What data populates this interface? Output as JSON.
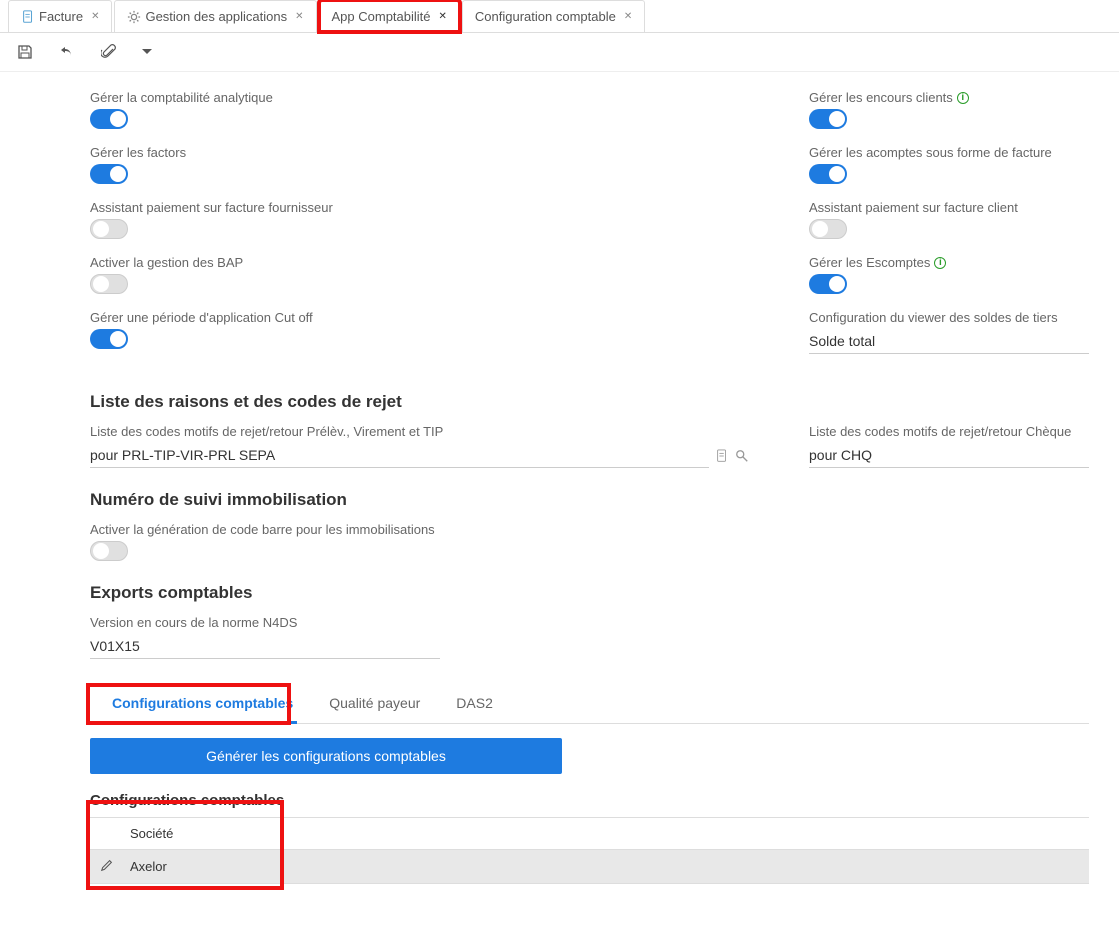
{
  "topTabs": [
    {
      "label": "Facture",
      "icon": "doc"
    },
    {
      "label": "Gestion des applications",
      "icon": "gear"
    },
    {
      "label": "App Comptabilité",
      "icon": null,
      "highlight": true
    },
    {
      "label": "Configuration comptable",
      "icon": null
    }
  ],
  "leftCol": [
    {
      "label": "Gérer la comptabilité analytique",
      "on": true
    },
    {
      "label": "Gérer les factors",
      "on": true
    },
    {
      "label": "Assistant paiement sur facture fournisseur",
      "on": false
    },
    {
      "label": "Activer la gestion des BAP",
      "on": false
    },
    {
      "label": "Gérer une période d'application Cut off",
      "on": true
    }
  ],
  "rightCol": [
    {
      "label": "Gérer les encours clients",
      "on": true,
      "info": true
    },
    {
      "label": "Gérer les acomptes sous forme de facture",
      "on": true
    },
    {
      "label": "Assistant paiement sur facture client",
      "on": false
    },
    {
      "label": "Gérer les Escomptes",
      "on": true,
      "info": true
    }
  ],
  "viewerConfig": {
    "label": "Configuration du viewer des soldes de tiers",
    "value": "Solde total"
  },
  "sectionRejet": {
    "title": "Liste des raisons et des codes de rejet",
    "left": {
      "label": "Liste des codes motifs de rejet/retour Prélèv., Virement et TIP",
      "value": "pour PRL-TIP-VIR-PRL SEPA"
    },
    "right": {
      "label": "Liste des codes motifs de rejet/retour Chèque",
      "value": "pour CHQ"
    }
  },
  "sectionImmo": {
    "title": "Numéro de suivi immobilisation",
    "barcode": {
      "label": "Activer la génération de code barre pour les immobilisations",
      "on": false
    }
  },
  "sectionExports": {
    "title": "Exports comptables",
    "n4ds": {
      "label": "Version en cours de la norme N4DS",
      "value": "V01X15"
    }
  },
  "subTabs": [
    "Configurations comptables",
    "Qualité payeur",
    "DAS2"
  ],
  "generateBtn": "Générer les configurations comptables",
  "configPanel": {
    "title": "Configurations comptables",
    "column": "Société",
    "row": "Axelor"
  }
}
